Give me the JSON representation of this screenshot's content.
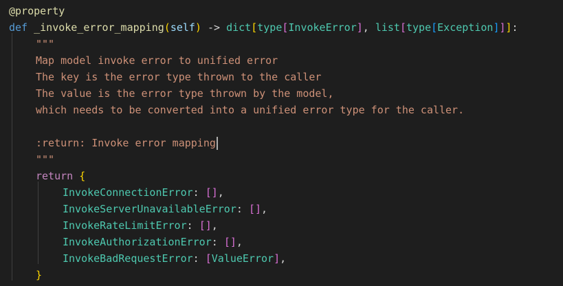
{
  "code": {
    "line1": {
      "decorator": "@property"
    },
    "line2": {
      "kw_def": "def",
      "fn_name": "_invoke_error_mapping",
      "paren_open": "(",
      "self": "self",
      "paren_close": ")",
      "arrow": " -> ",
      "dict": "dict",
      "b_open1": "[",
      "type1": "type",
      "b_open2": "[",
      "invoke_error": "InvokeError",
      "b_close2": "]",
      "comma": ", ",
      "list": "list",
      "b_open3": "[",
      "type2": "type",
      "b_open4": "[",
      "exception": "Exception",
      "b_close4": "]",
      "b_close3": "]",
      "b_close1": "]",
      "colon": ":"
    },
    "docstring": {
      "open_quotes": "\"\"\"",
      "line1": "Map model invoke error to unified error",
      "line2": "The key is the error type thrown to the caller",
      "line3": "The value is the error type thrown by the model,",
      "line4": "which needs to be converted into a unified error type for the caller.",
      "line5": ":return: Invoke error mapping",
      "close_quotes": "\"\"\""
    },
    "return_line": {
      "kw": "return",
      "brace_open": "{"
    },
    "entries": [
      {
        "name": "InvokeConnectionError",
        "sep": ": ",
        "open": "[",
        "value": "",
        "close": "]",
        "tail": ","
      },
      {
        "name": "InvokeServerUnavailableError",
        "sep": ": ",
        "open": "[",
        "value": "",
        "close": "]",
        "tail": ","
      },
      {
        "name": "InvokeRateLimitError",
        "sep": ": ",
        "open": "[",
        "value": "",
        "close": "]",
        "tail": ","
      },
      {
        "name": "InvokeAuthorizationError",
        "sep": ": ",
        "open": "[",
        "value": "",
        "close": "]",
        "tail": ","
      },
      {
        "name": "InvokeBadRequestError",
        "sep": ": ",
        "open": "[",
        "value": "ValueError",
        "close": "]",
        "tail": ","
      }
    ],
    "closing_brace": "}"
  },
  "colors": {
    "background": "#1e1e1e",
    "keyword": "#569cd6",
    "function": "#dcdcaa",
    "type": "#4ec9b0",
    "string": "#ce9178",
    "control": "#c586c0",
    "bracket_gold": "#ffd700",
    "bracket_orchid": "#da70d6",
    "bracket_blue": "#179fff"
  }
}
